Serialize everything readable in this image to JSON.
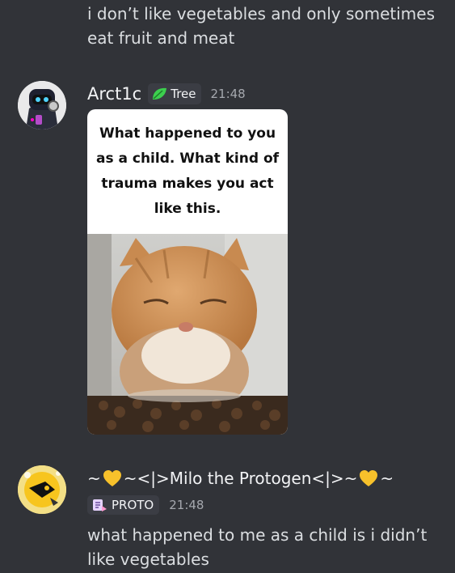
{
  "message_prev": {
    "text": "i don’t like vegetables and only sometimes eat fruit and meat"
  },
  "message1": {
    "username": "Arct1c",
    "tag": "Tree",
    "time": "21:48",
    "meme_caption": "What happened to you as a child. What kind of trauma makes you act like this."
  },
  "message2": {
    "username_left": "~",
    "username_mid": "~<|>Milo the Protogen<|>~",
    "username_right": "~",
    "role": "PROTO",
    "time": "21:48",
    "text": "what happened to me as a child is i didn’t like vegetables"
  },
  "colors": {
    "background": "#313338",
    "text": "#dbdee1",
    "muted": "#a5a8ae",
    "tag_bg": "#3b3d44"
  }
}
